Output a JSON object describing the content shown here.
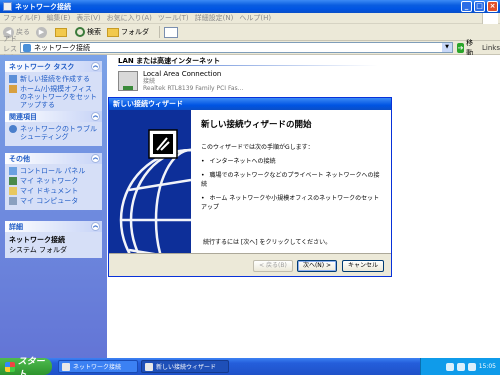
{
  "window": {
    "title": "ネットワーク接続"
  },
  "menu": [
    "ファイル(F)",
    "編集(E)",
    "表示(V)",
    "お気に入り(A)",
    "ツール(T)",
    "詳細設定(N)",
    "ヘルプ(H)"
  ],
  "toolbar": {
    "back": "戻る",
    "search": "検索",
    "folder": "フォルダ"
  },
  "address": {
    "label": "アドレス(D)",
    "value": "ネットワーク接続",
    "go": "移動",
    "links": "Links"
  },
  "left": {
    "network_tasks": {
      "title": "ネットワーク タスク",
      "items": [
        "新しい接続を作成する",
        "ホーム/小規模オフィスのネットワークをセットアップする"
      ]
    },
    "related": {
      "title": "関連項目",
      "items": [
        "ネットワークのトラブルシューティング"
      ]
    },
    "other": {
      "title": "その他",
      "items": [
        "コントロール パネル",
        "マイ ネットワーク",
        "マイ ドキュメント",
        "マイ コンピュータ"
      ]
    },
    "details": {
      "title": "詳細",
      "name": "ネットワーク接続",
      "type": "システム フォルダ"
    }
  },
  "content": {
    "group": "LAN または高速インターネット",
    "connection": {
      "name": "Local Area Connection",
      "status": "接続",
      "device": "Realtek RTL8139 Family PCI Fas..."
    }
  },
  "wizard": {
    "title": "新しい接続ウィザード",
    "heading": "新しい接続ウィザードの開始",
    "intro": "このウィザードでは次の手順がGします：",
    "bullets": [
      "インターネットへの接続",
      "職場でのネットワークなどのプライベート ネットワークへの接続",
      "ホーム ネットワークや小規模オフィスのネットワークのセットアップ"
    ],
    "footer": "続行するには [次へ] をクリックしてください。",
    "back": "< 戻る(B)",
    "next": "次へ(N) >",
    "cancel": "キャンセル"
  },
  "taskbar": {
    "start": "スタート",
    "tasks": [
      "ネットワーク接続",
      "新しい接続ウィザード"
    ],
    "time": "15:05"
  }
}
